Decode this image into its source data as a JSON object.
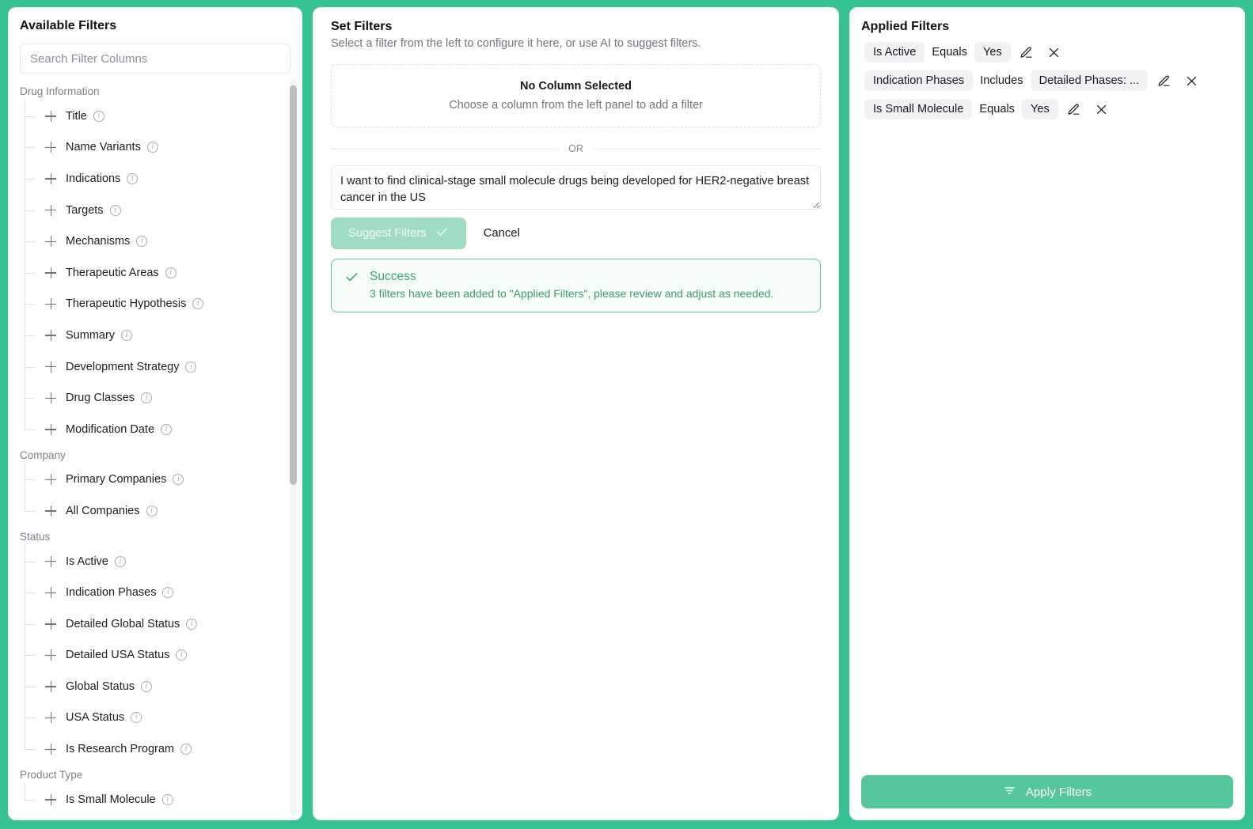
{
  "theme": {
    "accent": "#36c391",
    "accent_button": "#55c79b",
    "accent_disabled": "#9fdcc2",
    "success_text": "#3aa478",
    "chip_bg": "#f1f2f4"
  },
  "left_panel": {
    "title": "Available Filters",
    "search": {
      "value": "",
      "placeholder": "Search Filter Columns"
    },
    "groups": [
      {
        "label": "Drug Information",
        "items": [
          {
            "label": "Title",
            "add_icon": "plus-icon",
            "info_icon": "info-icon"
          },
          {
            "label": "Name Variants",
            "add_icon": "plus-icon",
            "info_icon": "info-icon"
          },
          {
            "label": "Indications",
            "add_icon": "plus-icon",
            "info_icon": "info-icon"
          },
          {
            "label": "Targets",
            "add_icon": "plus-icon",
            "info_icon": "info-icon"
          },
          {
            "label": "Mechanisms",
            "add_icon": "plus-icon",
            "info_icon": "info-icon"
          },
          {
            "label": "Therapeutic Areas",
            "add_icon": "plus-icon",
            "info_icon": "info-icon"
          },
          {
            "label": "Therapeutic Hypothesis",
            "add_icon": "plus-icon",
            "info_icon": "info-icon"
          },
          {
            "label": "Summary",
            "add_icon": "plus-icon",
            "info_icon": "info-icon"
          },
          {
            "label": "Development Strategy",
            "add_icon": "plus-icon",
            "info_icon": "info-icon"
          },
          {
            "label": "Drug Classes",
            "add_icon": "plus-icon",
            "info_icon": "info-icon"
          },
          {
            "label": "Modification Date",
            "add_icon": "plus-icon",
            "info_icon": "info-icon"
          }
        ]
      },
      {
        "label": "Company",
        "items": [
          {
            "label": "Primary Companies",
            "add_icon": "plus-icon",
            "info_icon": "info-icon"
          },
          {
            "label": "All Companies",
            "add_icon": "plus-icon",
            "info_icon": "info-icon"
          }
        ]
      },
      {
        "label": "Status",
        "items": [
          {
            "label": "Is Active",
            "add_icon": "plus-icon",
            "info_icon": "info-icon"
          },
          {
            "label": "Indication Phases",
            "add_icon": "plus-icon",
            "info_icon": "info-icon"
          },
          {
            "label": "Detailed Global Status",
            "add_icon": "plus-icon",
            "info_icon": "info-icon"
          },
          {
            "label": "Detailed USA Status",
            "add_icon": "plus-icon",
            "info_icon": "info-icon"
          },
          {
            "label": "Global Status",
            "add_icon": "plus-icon",
            "info_icon": "info-icon"
          },
          {
            "label": "USA Status",
            "add_icon": "plus-icon",
            "info_icon": "info-icon"
          },
          {
            "label": "Is Research Program",
            "add_icon": "plus-icon",
            "info_icon": "info-icon"
          }
        ]
      },
      {
        "label": "Product Type",
        "items": [
          {
            "label": "Is Small Molecule",
            "add_icon": "plus-icon",
            "info_icon": "info-icon"
          }
        ]
      }
    ]
  },
  "middle_panel": {
    "title": "Set Filters",
    "subtitle": "Select a filter from the left to configure it here, or use AI to suggest filters.",
    "empty_state": {
      "title": "No Column Selected",
      "subtitle": "Choose a column from the left panel to add a filter"
    },
    "divider_label": "OR",
    "ai_input": {
      "value": "I want to find clinical-stage small molecule drugs being developed for HER2-negative breast cancer in the US",
      "placeholder": ""
    },
    "suggest_button": {
      "label": "Suggest Filters",
      "icon": "check-icon",
      "disabled": true
    },
    "cancel_button": {
      "label": "Cancel"
    },
    "success": {
      "icon": "check-icon",
      "title": "Success",
      "message": "3 filters have been added to \"Applied Filters\", please review and adjust as needed."
    }
  },
  "right_panel": {
    "title": "Applied Filters",
    "filters": [
      {
        "field": "Is Active",
        "operator": "Equals",
        "value": "Yes",
        "edit_icon": "pencil-icon",
        "remove_icon": "close-icon"
      },
      {
        "field": "Indication Phases",
        "operator": "Includes",
        "value": "Detailed Phases: ...",
        "edit_icon": "pencil-icon",
        "remove_icon": "close-icon"
      },
      {
        "field": "Is Small Molecule",
        "operator": "Equals",
        "value": "Yes",
        "edit_icon": "pencil-icon",
        "remove_icon": "close-icon"
      }
    ],
    "apply_button": {
      "label": "Apply Filters",
      "icon": "filter-icon"
    }
  }
}
